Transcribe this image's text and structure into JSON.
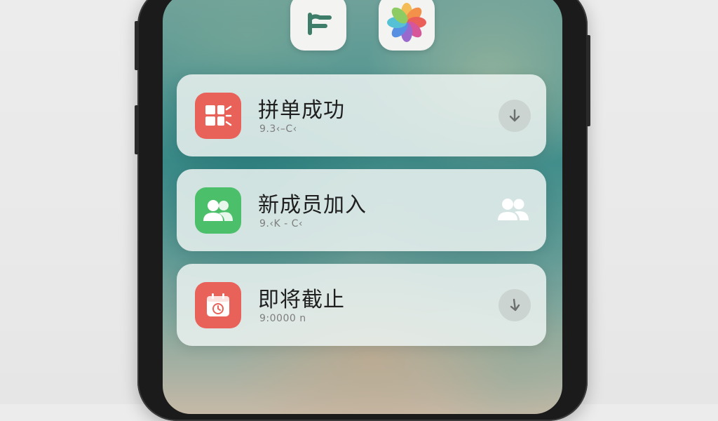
{
  "home_icons": [
    {
      "name": "feishu",
      "glyph": "⊏"
    },
    {
      "name": "photos"
    }
  ],
  "notifications": [
    {
      "title": "拼单成功",
      "subtitle": "9.3‹–C‹",
      "icon": "grid-icon",
      "icon_color": "#e9625a",
      "action_icon": "arrow-down-icon"
    },
    {
      "title": "新成员加入",
      "subtitle": "9.‹K - C‹",
      "icon": "people-icon",
      "icon_color": "#4cbf6a",
      "action_icon": "people-icon"
    },
    {
      "title": "即将截止",
      "subtitle": "9:0000 n",
      "icon": "calendar-icon",
      "icon_color": "#e9625a",
      "action_icon": "arrow-down-icon"
    }
  ]
}
